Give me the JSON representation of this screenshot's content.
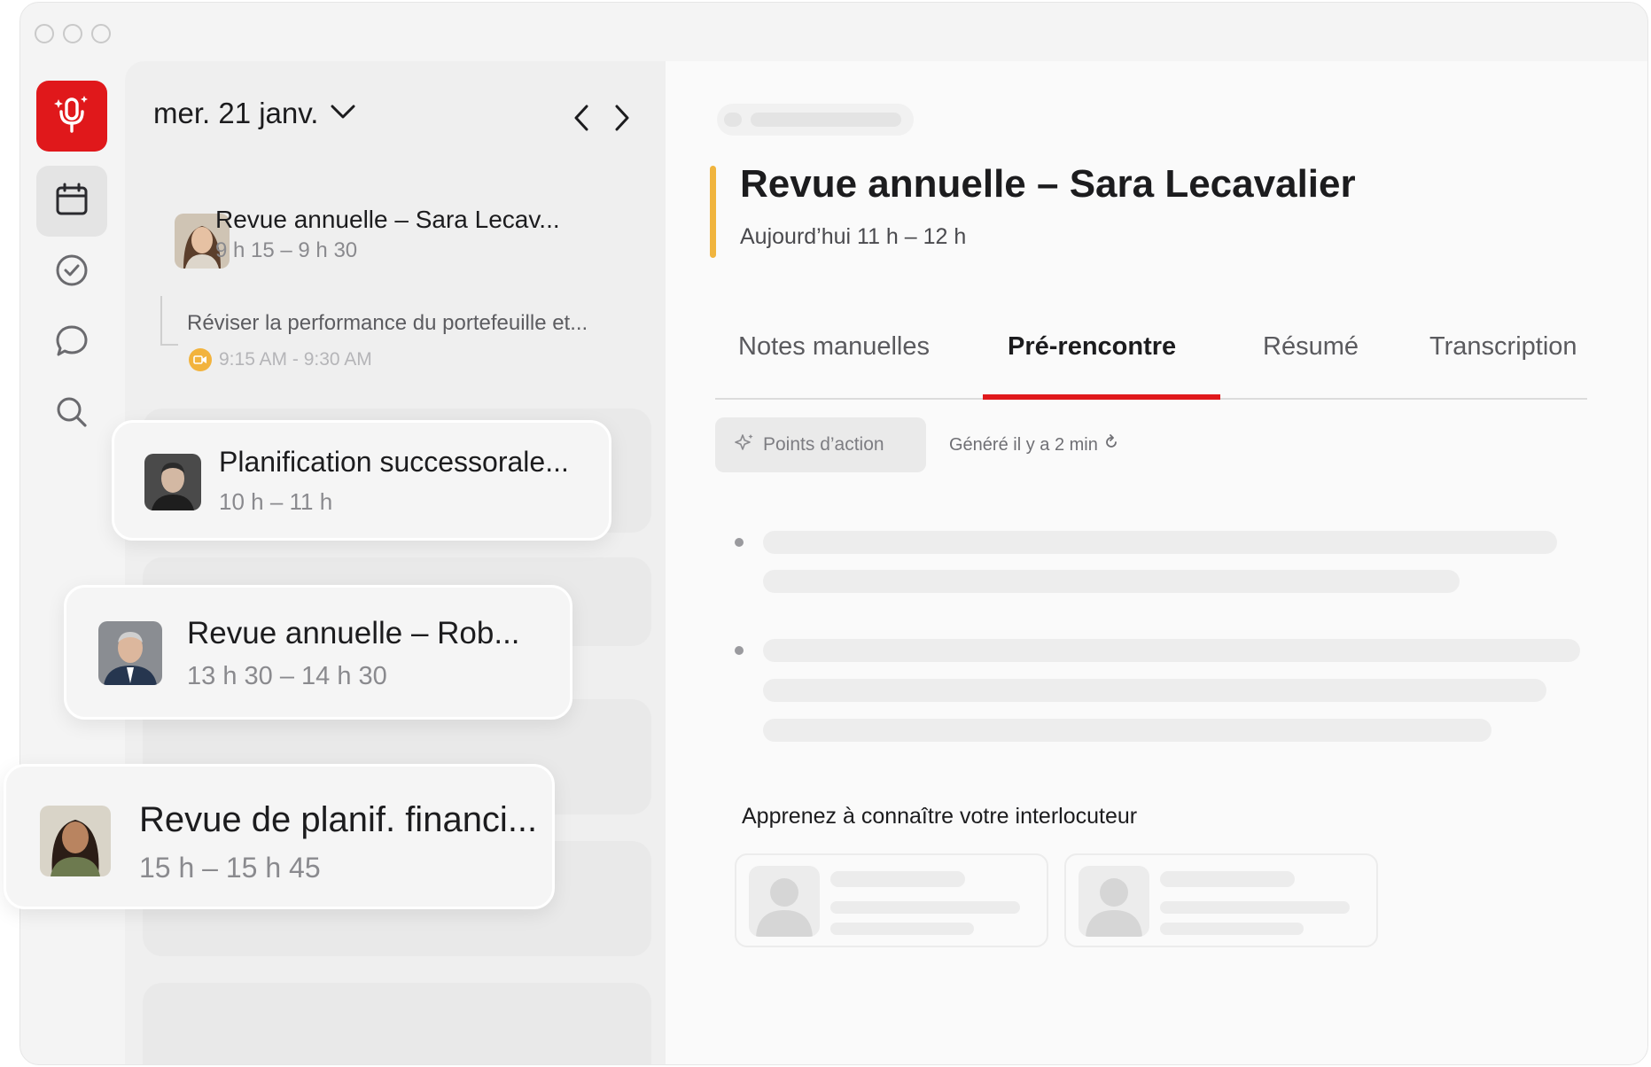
{
  "header": {
    "date_label": "mer. 21 janv."
  },
  "sidebar": {
    "items": [
      {
        "name": "record",
        "icon": "microphone-icon"
      },
      {
        "name": "calendar",
        "icon": "calendar-icon"
      },
      {
        "name": "tasks",
        "icon": "check-circle-icon"
      },
      {
        "name": "chat",
        "icon": "chat-bubble-icon"
      },
      {
        "name": "search",
        "icon": "search-icon"
      }
    ]
  },
  "events": [
    {
      "title": "Revue annuelle – Sara Lecav...",
      "time": "9 h 15 – 9 h 30"
    },
    {
      "title": "Planification successorale...",
      "time": "10 h – 11 h"
    },
    {
      "title": "Revue annuelle – Rob...",
      "time": "13 h 30 – 14 h 30"
    },
    {
      "title": "Revue de planif. financi...",
      "time": "15 h – 15 h 45"
    }
  ],
  "sub_item": {
    "note": "Réviser la performance du portefeuille et...",
    "time": "9:15 AM - 9:30 AM"
  },
  "detail": {
    "title": "Revue annuelle – Sara Lecavalier",
    "subtitle": "Aujourd’hui 11 h – 12 h",
    "tabs": [
      {
        "label": "Notes manuelles"
      },
      {
        "label": "Pré-rencontre"
      },
      {
        "label": "Résumé"
      },
      {
        "label": "Transcription"
      }
    ],
    "active_tab": "Pré-rencontre",
    "action_button": "Points d’action",
    "generated": "Généré il y a 2 min",
    "section_title": "Apprenez à connaître votre interlocuteur"
  },
  "colors": {
    "brand_red": "#e0181b",
    "accent_yellow": "#f0b43e",
    "background": "#f4f4f4"
  }
}
